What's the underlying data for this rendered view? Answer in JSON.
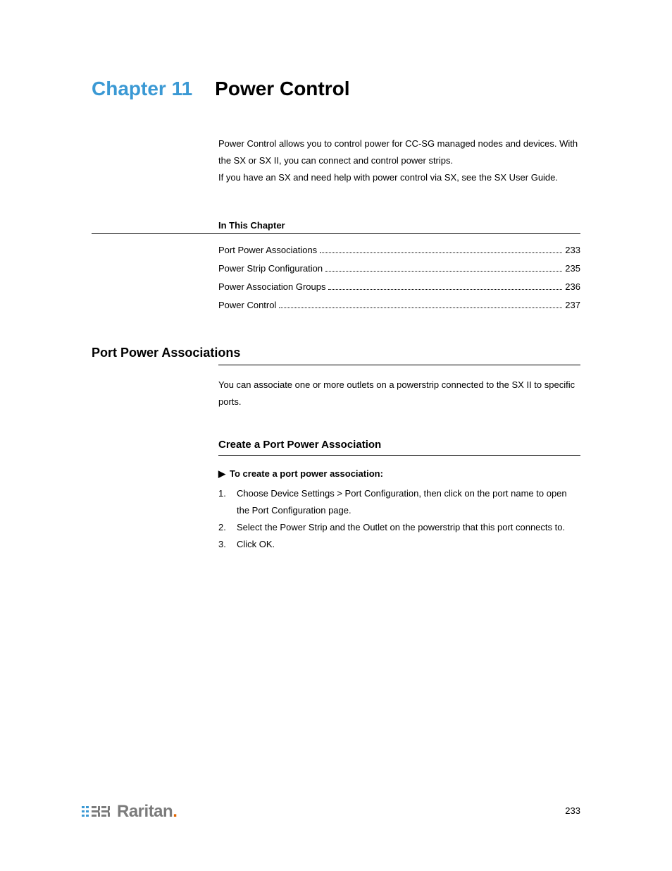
{
  "chapter": {
    "label": "Chapter 11",
    "title": "Power Control"
  },
  "intro": {
    "p1": "Power Control allows you to control power for CC-SG managed nodes and devices. With the SX or SX II, you can connect and control power strips.",
    "p2": "If you have an SX and need help with power control via SX, see the SX User Guide."
  },
  "inThisChapter": {
    "label": "In This Chapter",
    "items": [
      {
        "title": "Port Power Associations",
        "page": "233"
      },
      {
        "title": "Power Strip Configuration",
        "page": "235"
      },
      {
        "title": "Power Association Groups",
        "page": "236"
      },
      {
        "title": "Power Control",
        "page": "237"
      }
    ]
  },
  "section1": {
    "heading": "Port Power Associations",
    "body": "You can associate one or more outlets on a powerstrip connected to the SX II to specific ports."
  },
  "section2": {
    "heading": "Create a Port Power Association",
    "lead": "To create a port power association:",
    "steps": [
      "Choose Device Settings > Port Configuration, then click on the port name to open the Port Configuration page.",
      "Select the Power Strip and the Outlet on the powerstrip that this port connects to.",
      "Click OK."
    ]
  },
  "footer": {
    "brand": "Raritan",
    "pageNumber": "233"
  }
}
